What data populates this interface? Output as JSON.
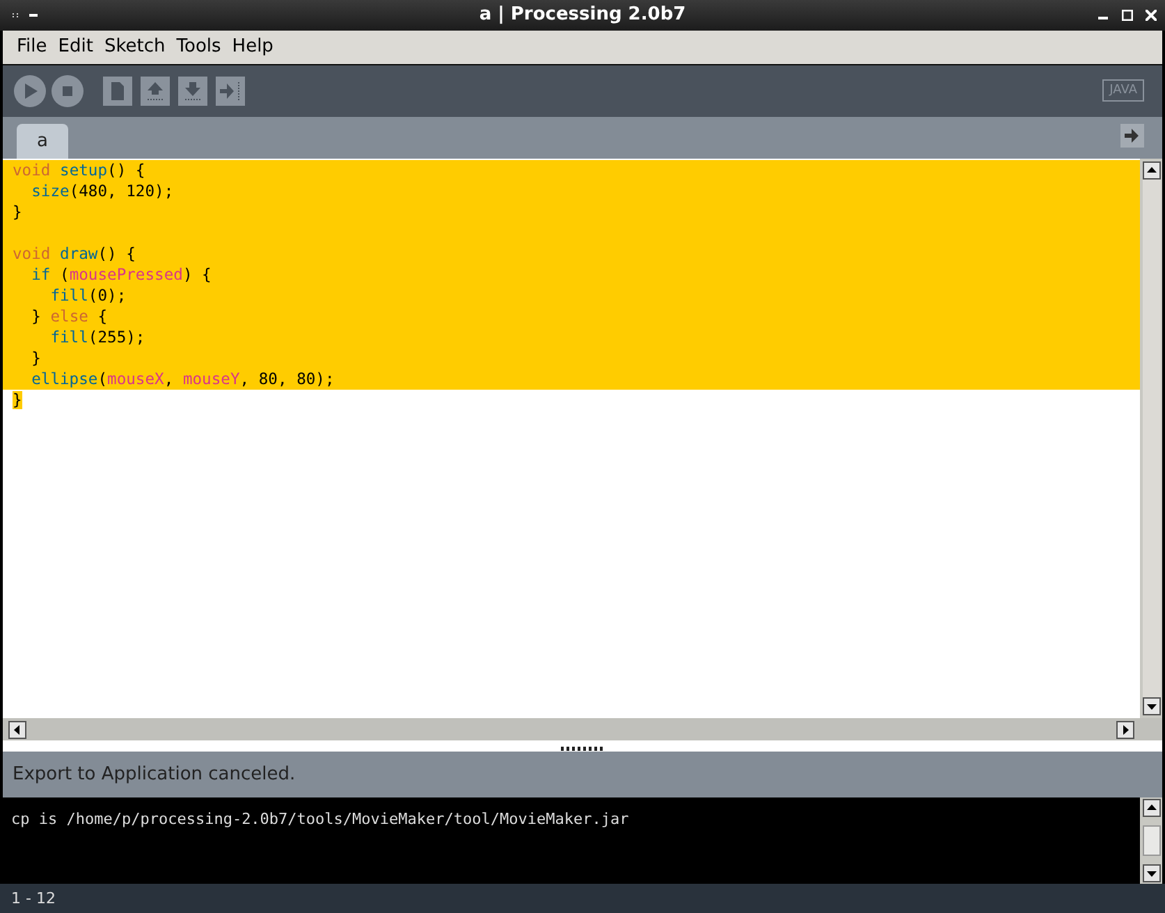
{
  "window": {
    "title": "a | Processing 2.0b7"
  },
  "menu": [
    "File",
    "Edit",
    "Sketch",
    "Tools",
    "Help"
  ],
  "toolbar": {
    "buttons": [
      {
        "kind": "run"
      },
      {
        "kind": "stop"
      },
      {
        "kind": "new"
      },
      {
        "kind": "open"
      },
      {
        "kind": "save"
      },
      {
        "kind": "export"
      }
    ],
    "mode": "JAVA"
  },
  "tabs": [
    {
      "label": "a",
      "selected": true
    }
  ],
  "editor": {
    "lines": [
      {
        "selected": true,
        "to_line_end": true,
        "tokens": [
          {
            "kind": "keyword",
            "text": "void"
          },
          {
            "kind": "function",
            "text": " setup"
          },
          {
            "kind": "plain",
            "text": "() {"
          }
        ]
      },
      {
        "selected": true,
        "to_line_end": true,
        "tokens": [
          {
            "kind": "function",
            "text": "  size"
          },
          {
            "kind": "plain",
            "text": "(480, 120);"
          }
        ]
      },
      {
        "selected": true,
        "to_line_end": true,
        "tokens": [
          {
            "kind": "plain",
            "text": "}"
          }
        ]
      },
      {
        "selected": true,
        "to_line_end": true
      },
      {
        "selected": true,
        "to_line_end": true,
        "tokens": [
          {
            "kind": "keyword",
            "text": "void"
          },
          {
            "kind": "function",
            "text": " draw"
          },
          {
            "kind": "plain",
            "text": "() {"
          }
        ]
      },
      {
        "selected": true,
        "to_line_end": true,
        "tokens": [
          {
            "kind": "function",
            "text": "  if"
          },
          {
            "kind": "plain",
            "text": " ("
          },
          {
            "kind": "variable",
            "text": "mousePressed"
          },
          {
            "kind": "plain",
            "text": ") {"
          }
        ]
      },
      {
        "selected": true,
        "to_line_end": true,
        "tokens": [
          {
            "kind": "function",
            "text": "    fill"
          },
          {
            "kind": "plain",
            "text": "(0);"
          }
        ]
      },
      {
        "selected": true,
        "to_line_end": true,
        "tokens": [
          {
            "kind": "plain",
            "text": "  } "
          },
          {
            "kind": "keyword",
            "text": "else"
          },
          {
            "kind": "plain",
            "text": " {"
          }
        ]
      },
      {
        "selected": true,
        "to_line_end": true,
        "tokens": [
          {
            "kind": "function",
            "text": "    fill"
          },
          {
            "kind": "plain",
            "text": "(255);"
          }
        ]
      },
      {
        "selected": true,
        "to_line_end": true,
        "tokens": [
          {
            "kind": "plain",
            "text": "  }"
          }
        ]
      },
      {
        "selected": true,
        "to_line_end": true,
        "tokens": [
          {
            "kind": "function",
            "text": "  ellipse"
          },
          {
            "kind": "plain",
            "text": "("
          },
          {
            "kind": "variable",
            "text": "mouseX"
          },
          {
            "kind": "plain",
            "text": ", "
          },
          {
            "kind": "variable",
            "text": "mouseY"
          },
          {
            "kind": "plain",
            "text": ", 80, 80);"
          }
        ]
      },
      {
        "selected": true,
        "to_line_end": false,
        "tokens": [
          {
            "kind": "plain",
            "text": "}"
          }
        ]
      }
    ]
  },
  "message": "Export to Application canceled.",
  "console": [
    "cp is /home/p/processing-2.0b7/tools/MovieMaker/tool/MovieMaker.jar"
  ],
  "status_bar": "1 - 12"
}
